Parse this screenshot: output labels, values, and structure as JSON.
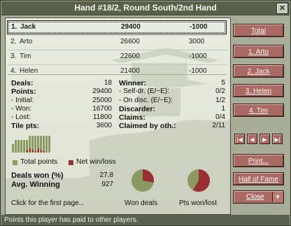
{
  "window": {
    "title": "Hand #18/2, Round South/2nd Hand",
    "close_glyph": "✕"
  },
  "players": [
    {
      "rank": "1.",
      "name": "Jack",
      "points": "29400",
      "delta": "-1000",
      "selected": true
    },
    {
      "rank": "2.",
      "name": "Arto",
      "points": "26600",
      "delta": "3000"
    },
    {
      "rank": "3.",
      "name": "Tim",
      "points": "22600",
      "delta": "-1000"
    },
    {
      "rank": "4.",
      "name": "Helen",
      "points": "21400",
      "delta": "-1000"
    }
  ],
  "stats_left": [
    {
      "label": "Deals:",
      "value": "18",
      "bold": true
    },
    {
      "label": "Points:",
      "value": "29400",
      "bold": true
    },
    {
      "label": "- Initial:",
      "value": "25000"
    },
    {
      "label": "- Won:",
      "value": "16700"
    },
    {
      "label": "- Lost:",
      "value": "11800"
    },
    {
      "label": "Tile pts:",
      "value": "3600",
      "bold": true
    }
  ],
  "stats_right": [
    {
      "label": "Winner:",
      "value": "5",
      "bold": true
    },
    {
      "label": "- Self-dr. (E/~E):",
      "value": "0/2"
    },
    {
      "label": "- On disc. (E/~E):",
      "value": "1/2"
    },
    {
      "label": "Discarder:",
      "value": "1",
      "bold": true
    },
    {
      "label": "Claims:",
      "value": "0/4",
      "bold": true
    },
    {
      "label": "Claimed by oth.:",
      "value": "2/11",
      "bold": true
    }
  ],
  "legend": {
    "total_points": "Total points",
    "net_win_loss": "Net win/loss"
  },
  "summary": {
    "deals_won_label": "Deals won (%)",
    "deals_won_value": "27.8",
    "avg_winning_label": "Avg. Winning",
    "avg_winning_value": "927"
  },
  "footer_hint": "Click for the first page...",
  "pie_captions": {
    "won_deals": "Won deals",
    "pts_won_lost": "Pts won/lost"
  },
  "pie_values": {
    "won_deals_fraction": 0.278,
    "pts_won_fraction": 0.586
  },
  "bars_values": [
    2,
    3,
    3,
    3,
    3,
    3,
    4,
    4,
    4,
    4,
    4,
    4,
    4,
    4
  ],
  "net_values": [
    1,
    2,
    1,
    0,
    2,
    1,
    0
  ],
  "colors": {
    "total_points": "#8a9a62",
    "net_win_loss": "#9a2f33",
    "button_face": "#a96a64",
    "title_bg": "#586049"
  },
  "buttons": {
    "total": "Total",
    "arto": "1. Arto",
    "jack": "2. Jack",
    "helen": "3. Helen",
    "tim": "4. Tim",
    "print": "Print...",
    "hall_of_fame": "Hall of Fame",
    "close": "Close"
  },
  "nav": {
    "first": "|◀",
    "prev": "◀",
    "next": "▶",
    "last": "▶|"
  },
  "status": "Points this player has paid to other players."
}
